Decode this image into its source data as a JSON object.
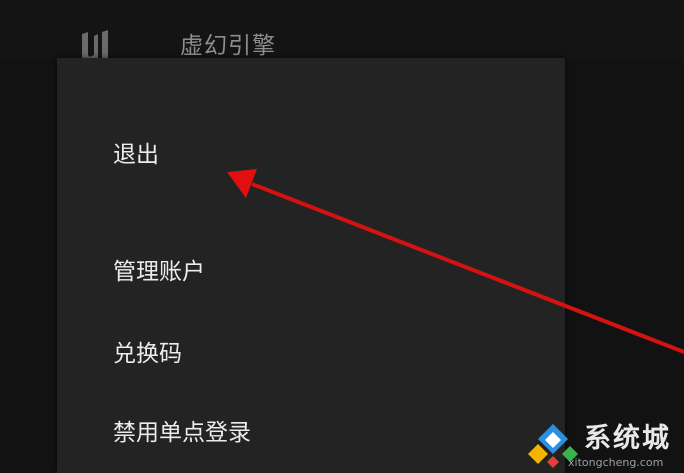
{
  "header": {
    "title": "虚幻引擎",
    "logo_icon": "unreal-engine-logo-icon"
  },
  "menu": {
    "items": [
      {
        "label": "退出"
      },
      {
        "label": "管理账户"
      },
      {
        "label": "兑换码"
      },
      {
        "label": "禁用单点登录"
      }
    ]
  },
  "annotation": {
    "arrow_color": "#e01010"
  },
  "watermark": {
    "brand": "系统城",
    "url": "xitongcheng.com"
  },
  "colors": {
    "background": "#121212",
    "panel": "#232323",
    "menu_text": "#ececec"
  }
}
